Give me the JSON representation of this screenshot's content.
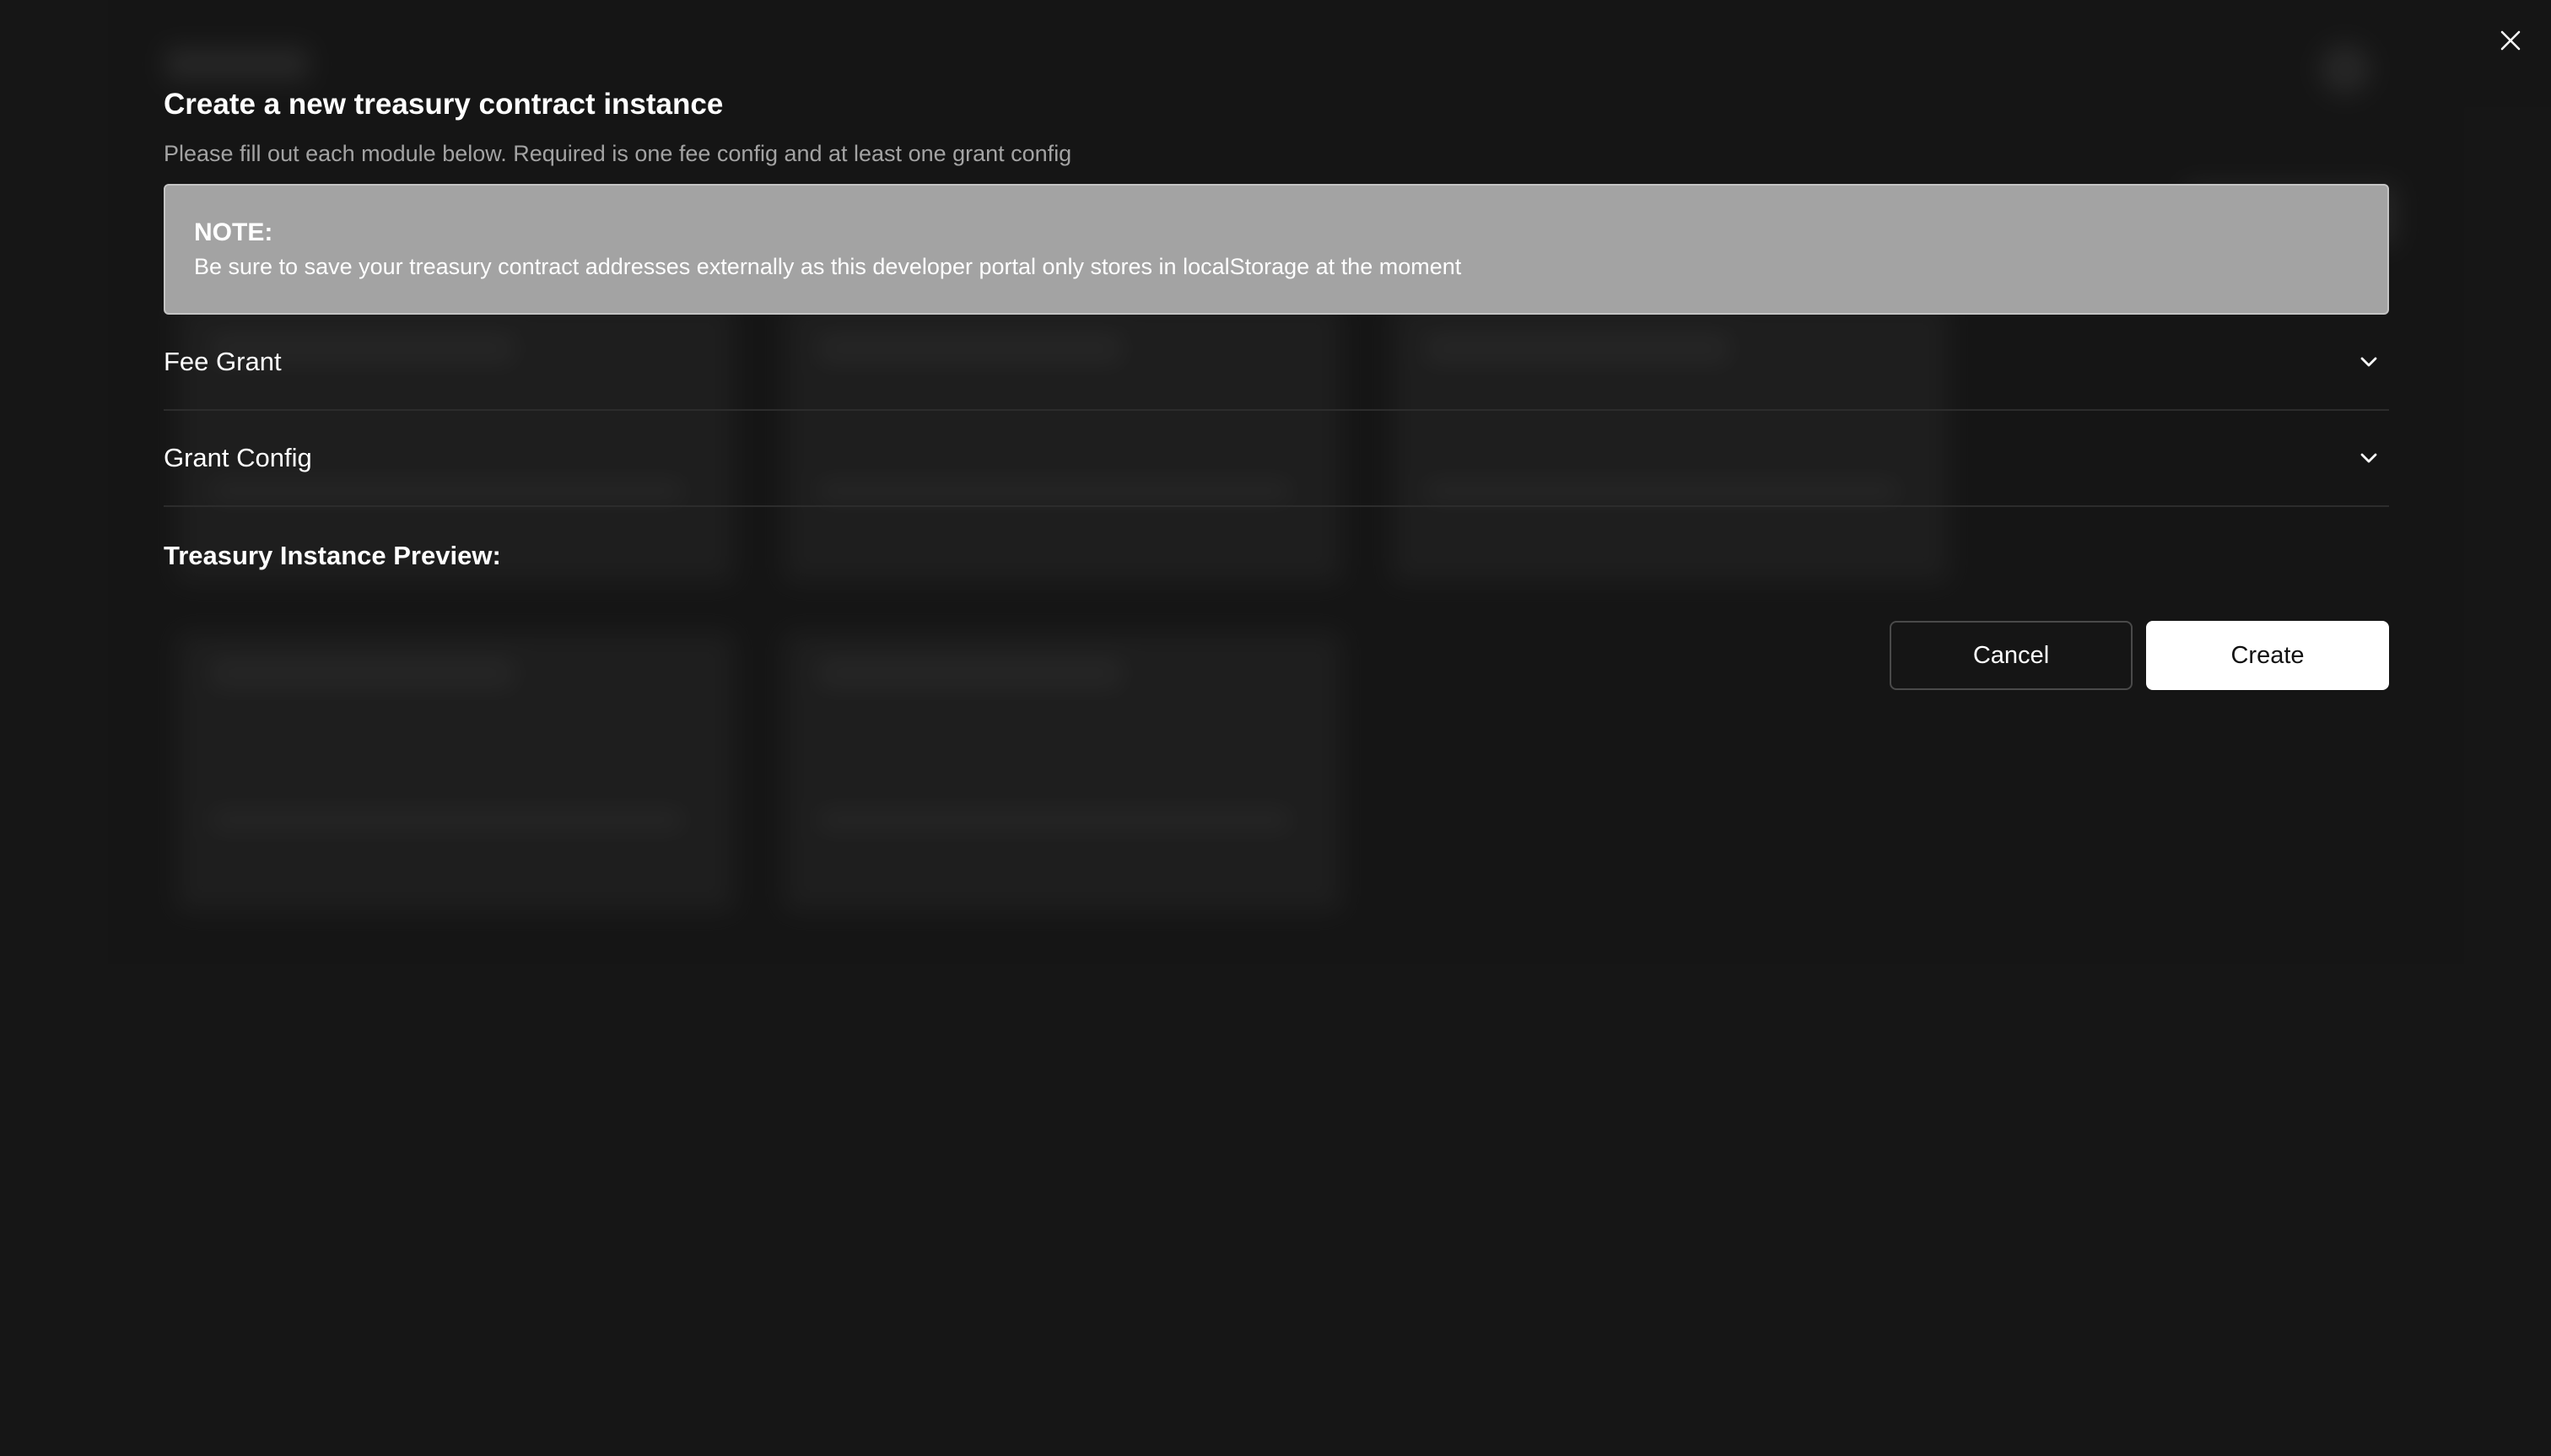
{
  "modal": {
    "title": "Create a new treasury contract instance",
    "subtitle": "Please fill out each module below. Required is one fee config and at least one grant config",
    "note": {
      "title": "NOTE:",
      "body": "Be sure to save your treasury contract addresses externally as this developer portal only stores in localStorage at the moment"
    },
    "sections": [
      {
        "label": "Fee Grant",
        "icon": "chevron-down-icon",
        "expanded": false
      },
      {
        "label": "Grant Config",
        "icon": "chevron-down-icon",
        "expanded": false
      }
    ],
    "preview_heading": "Treasury Instance Preview:",
    "cancel_label": "Cancel",
    "create_label": "Create",
    "close_icon": "close-icon"
  },
  "colors": {
    "background": "#181818",
    "note_background": "#a3a3a3",
    "subtitle_text": "#a3a3a3",
    "primary_button": "#ffffff",
    "divider": "#2c2c2c"
  }
}
